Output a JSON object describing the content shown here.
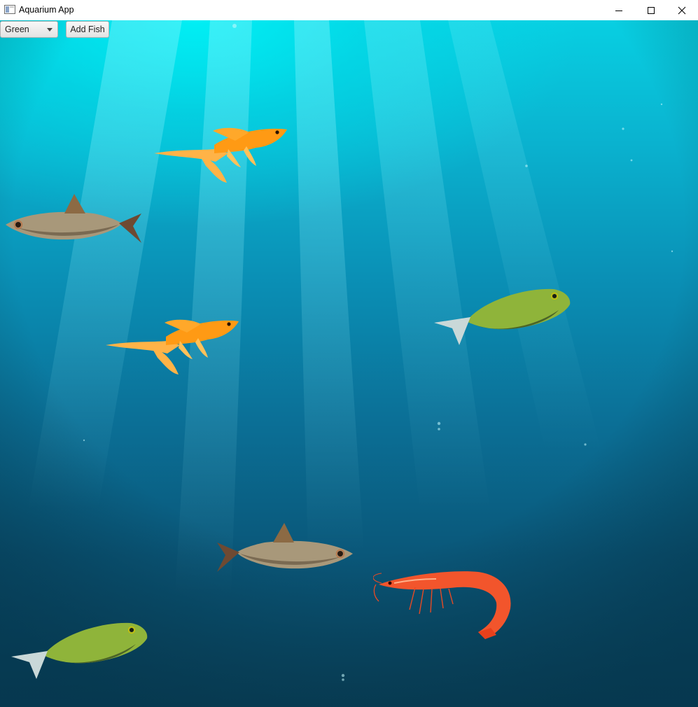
{
  "window": {
    "title": "Aquarium App",
    "controls": [
      "minimize-icon",
      "maximize-icon",
      "close-icon"
    ]
  },
  "toolbar": {
    "color_select": {
      "selected": "Green"
    },
    "add_button_label": "Add Fish"
  },
  "aquarium": {
    "background": "underwater-rays",
    "creatures": [
      {
        "kind": "goldfish",
        "facing": "right"
      },
      {
        "kind": "silver-fish",
        "facing": "left"
      },
      {
        "kind": "green-fish",
        "facing": "right"
      },
      {
        "kind": "goldfish",
        "facing": "right"
      },
      {
        "kind": "silver-fish",
        "facing": "right"
      },
      {
        "kind": "shrimp",
        "facing": "left"
      },
      {
        "kind": "green-fish",
        "facing": "right"
      }
    ]
  },
  "colors": {
    "water_top": "#08cfe2",
    "water_bottom": "#0a4a66",
    "goldfish": "#ff9c1a",
    "green_fish": "#8fb43a",
    "silver_fish": "#b8a88a",
    "shrimp": "#f2552c"
  }
}
